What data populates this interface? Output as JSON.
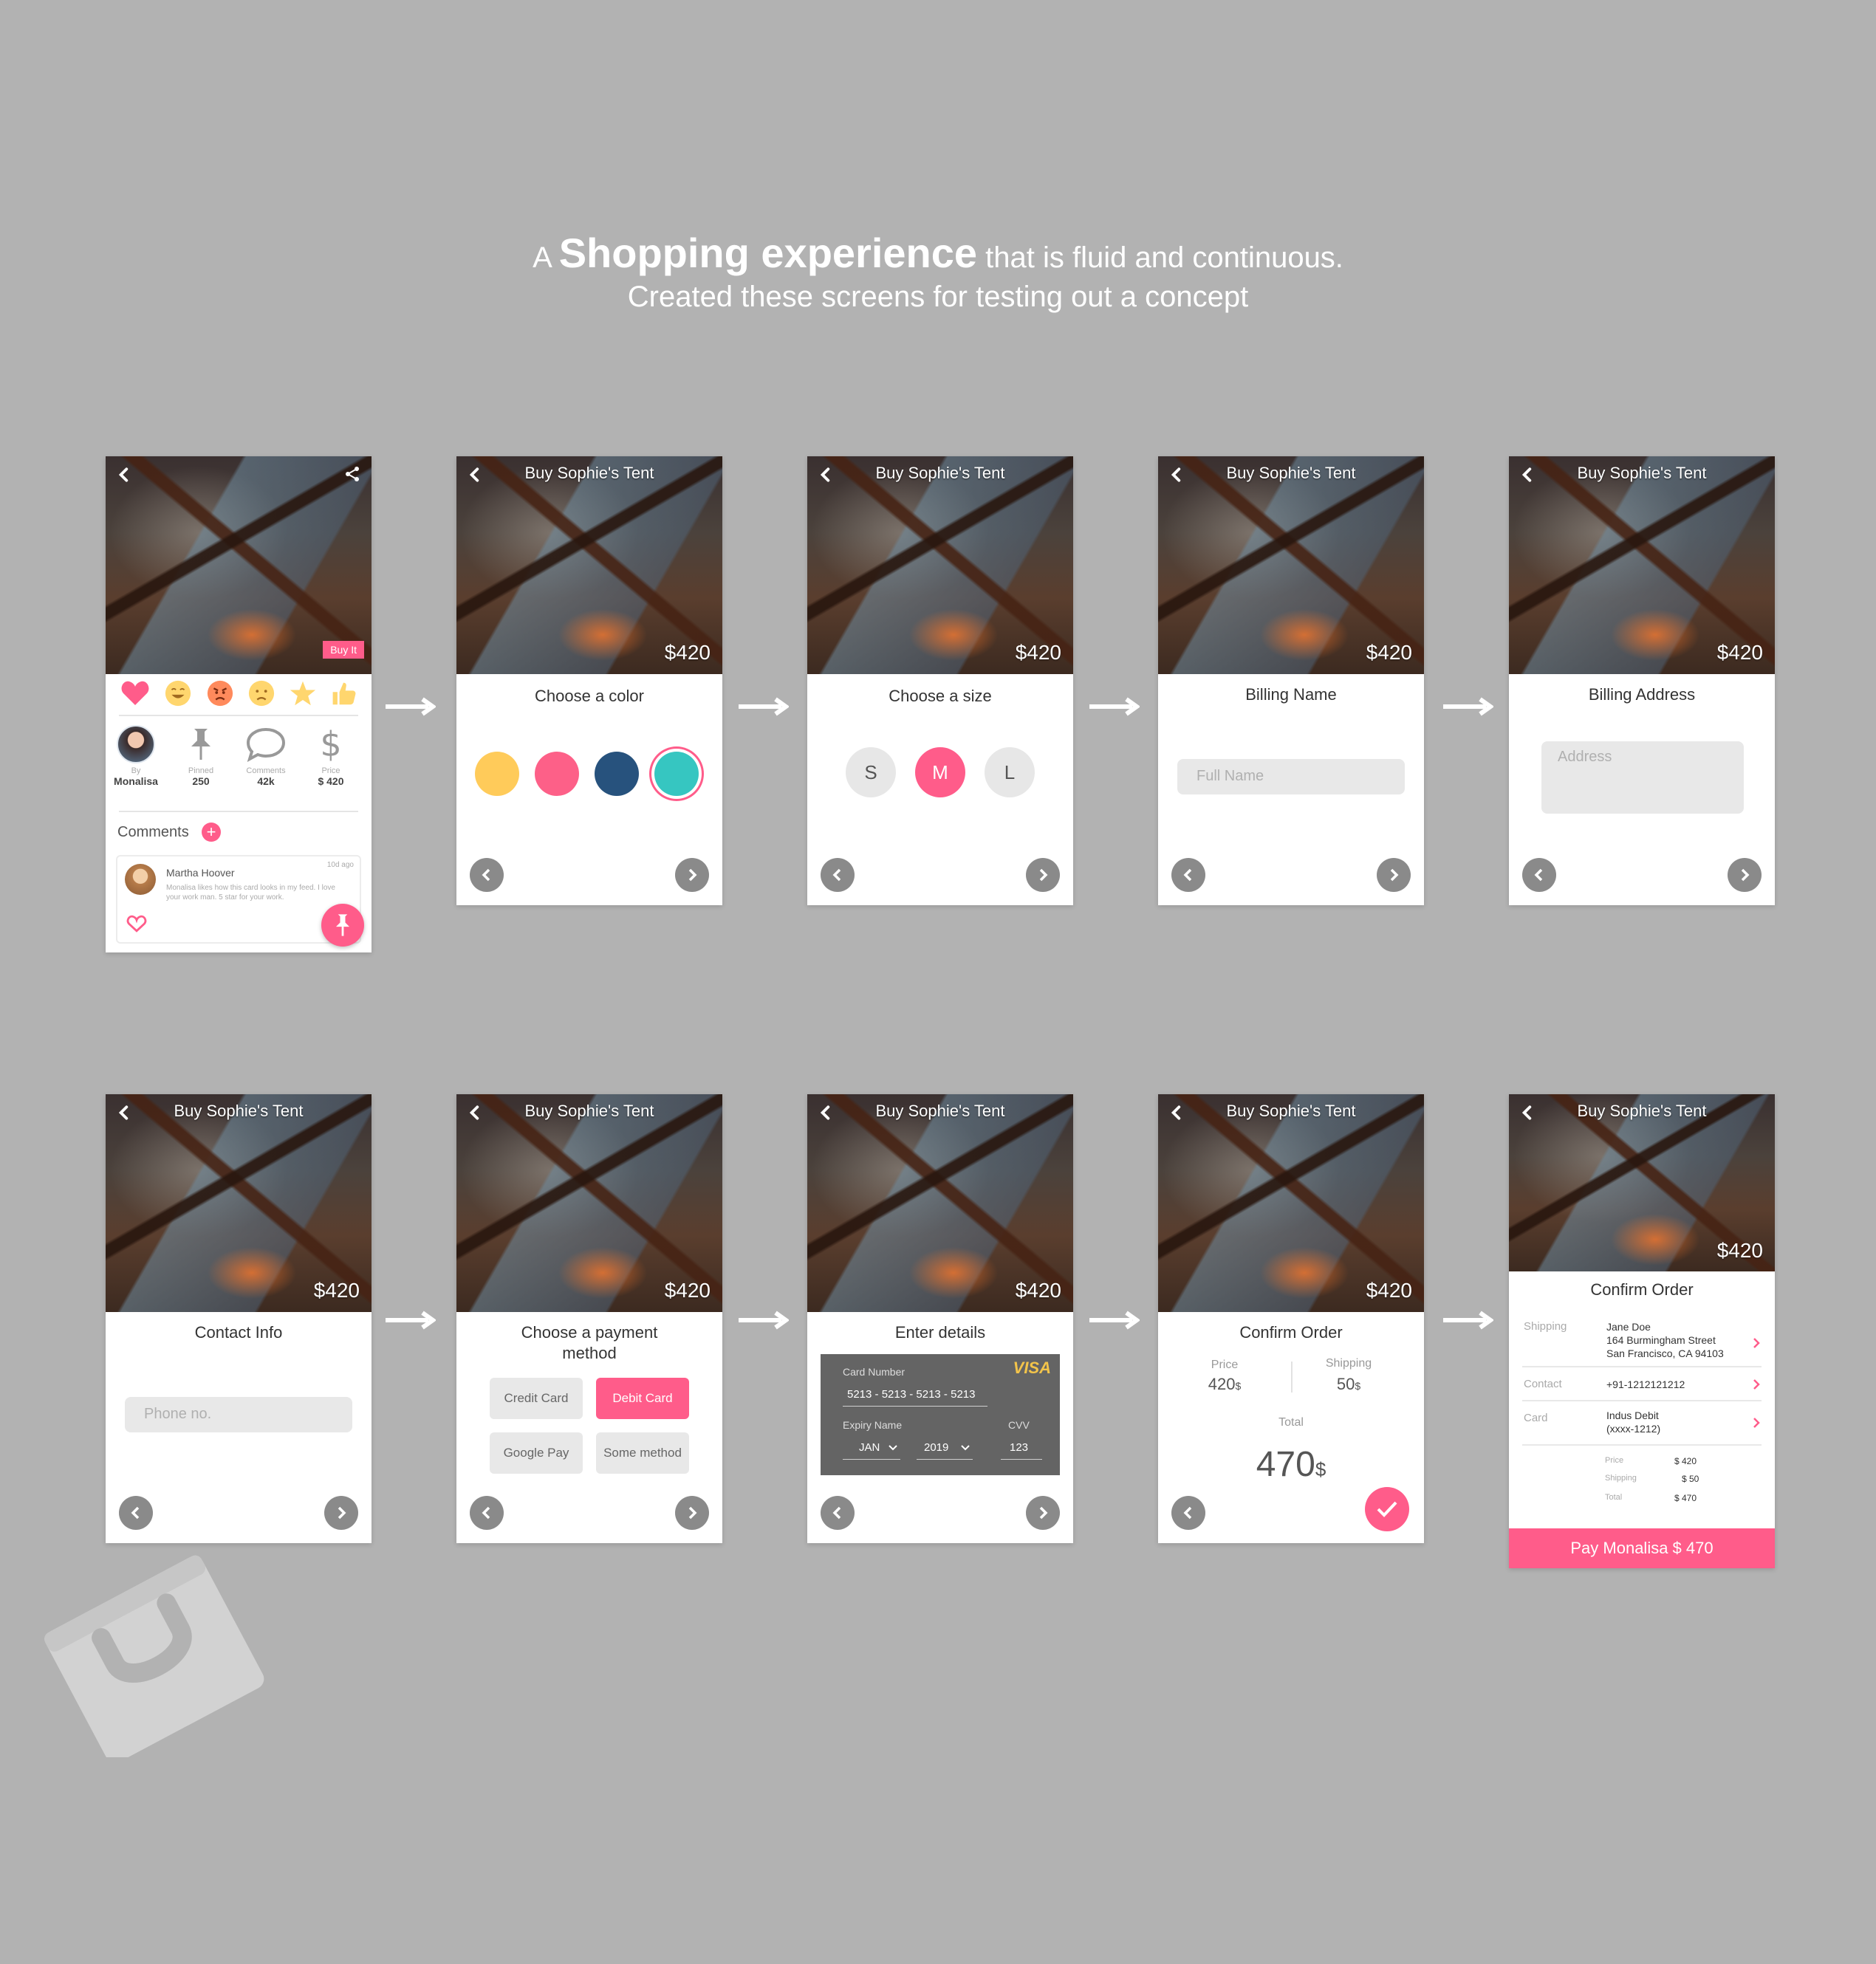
{
  "header": {
    "pre": "A",
    "strong": "Shopping experience",
    "post": "that is fluid and continuous.",
    "subtitle": "Created these screens for testing out a concept"
  },
  "product": {
    "title": "Buy Sophie's Tent",
    "price": "$420"
  },
  "card1": {
    "buy_label": "Buy It",
    "stats": [
      {
        "label": "By",
        "value": "Monalisa"
      },
      {
        "label": "Pinned",
        "value": "250"
      },
      {
        "label": "Comments",
        "value": "42k"
      },
      {
        "label": "Price",
        "value": "$ 420"
      }
    ],
    "comments_heading": "Comments",
    "comment": {
      "author": "Martha Hoover",
      "time": "10d ago",
      "text": "Monalisa likes how this card looks in my feed. I love your work man. 5 star for your work."
    },
    "emojis": [
      "heart-icon",
      "laugh-emoji-icon",
      "angry-emoji-icon",
      "sad-emoji-icon",
      "star-icon",
      "thumbs-up-icon"
    ]
  },
  "color_step": {
    "label": "Choose a color",
    "swatches": [
      "#ffcb5a",
      "#fd6088",
      "#27527d",
      "#36c6c1"
    ],
    "selected_index": 3
  },
  "size_step": {
    "label": "Choose a size",
    "sizes": [
      "S",
      "M",
      "L"
    ],
    "selected": "M"
  },
  "billing_name": {
    "label": "Billing Name",
    "placeholder": "Full Name"
  },
  "billing_address": {
    "label": "Billing Address",
    "placeholder": "Address"
  },
  "contact": {
    "label": "Contact Info",
    "placeholder": "Phone no."
  },
  "payment": {
    "label_line1": "Choose a payment",
    "label_line2": "method",
    "methods": [
      "Credit Card",
      "Debit Card",
      "Google Pay",
      "Some method"
    ],
    "selected": "Debit Card"
  },
  "details": {
    "label": "Enter details",
    "brand": "VISA",
    "card_number_label": "Card Number",
    "card_number": "5213 - 5213 - 5213 - 5213",
    "expiry_label": "Expiry Name",
    "month": "JAN",
    "year": "2019",
    "cvv_label": "CVV",
    "cvv": "123"
  },
  "confirm": {
    "label": "Confirm Order",
    "price_label": "Price",
    "price_value": "420",
    "shipping_label": "Shipping",
    "shipping_value": "50",
    "currency": "$",
    "total_label": "Total",
    "total_value": "470"
  },
  "summary": {
    "label": "Confirm Order",
    "shipping_label": "Shipping",
    "shipping_lines": [
      "Jane Doe",
      "164 Burmingham Street",
      "San Francisco, CA 94103"
    ],
    "contact_label": "Contact",
    "contact_value": "+91-1212121212",
    "card_label": "Card",
    "card_lines": [
      "Indus Debit",
      "(xxxx-1212)"
    ],
    "breakdown": [
      {
        "label": "Price",
        "value": "$ 420"
      },
      {
        "label": "Shipping",
        "value": "$ 50"
      },
      {
        "label": "Total",
        "value": "$ 470"
      }
    ],
    "pay_button": "Pay Monalisa $ 470"
  },
  "colors": {
    "background": "#b2b2b2",
    "accent": "#ff5c8a",
    "nav_button": "#8a8a8a"
  }
}
